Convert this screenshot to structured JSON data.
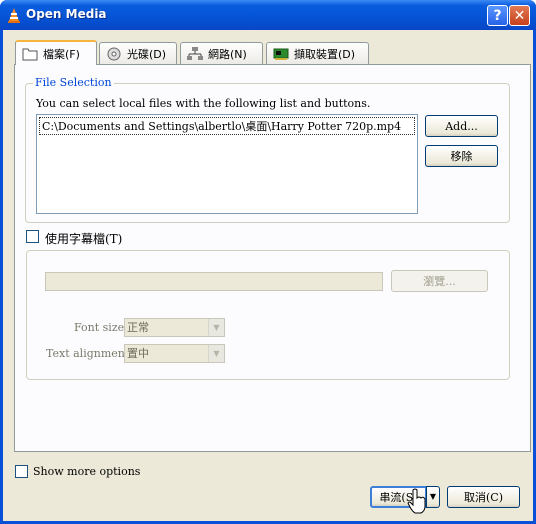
{
  "window": {
    "title": "Open Media"
  },
  "tabs": [
    {
      "label": "檔案(F)",
      "icon": "folder-icon"
    },
    {
      "label": "光碟(D)",
      "icon": "disc-icon"
    },
    {
      "label": "網路(N)",
      "icon": "network-icon"
    },
    {
      "label": "擷取裝置(D)",
      "icon": "capture-card-icon"
    }
  ],
  "file_selection": {
    "legend": "File Selection",
    "hint": "You can select local files with the following list and buttons.",
    "files": [
      "C:\\Documents and Settings\\albertlo\\桌面\\Harry Potter 720p.mp4"
    ],
    "add_label": "Add...",
    "remove_label": "移除"
  },
  "subtitle": {
    "checkbox_label": "使用字幕檔(T)",
    "browse_label": "瀏覽...",
    "font_size_label": "Font size:",
    "font_size_value": "正常",
    "text_alignment_label": "Text alignment:",
    "text_alignment_value": "置中"
  },
  "footer": {
    "show_more_label": "Show more options",
    "stream_label": "串流(S)",
    "cancel_label": "取消(C)"
  }
}
